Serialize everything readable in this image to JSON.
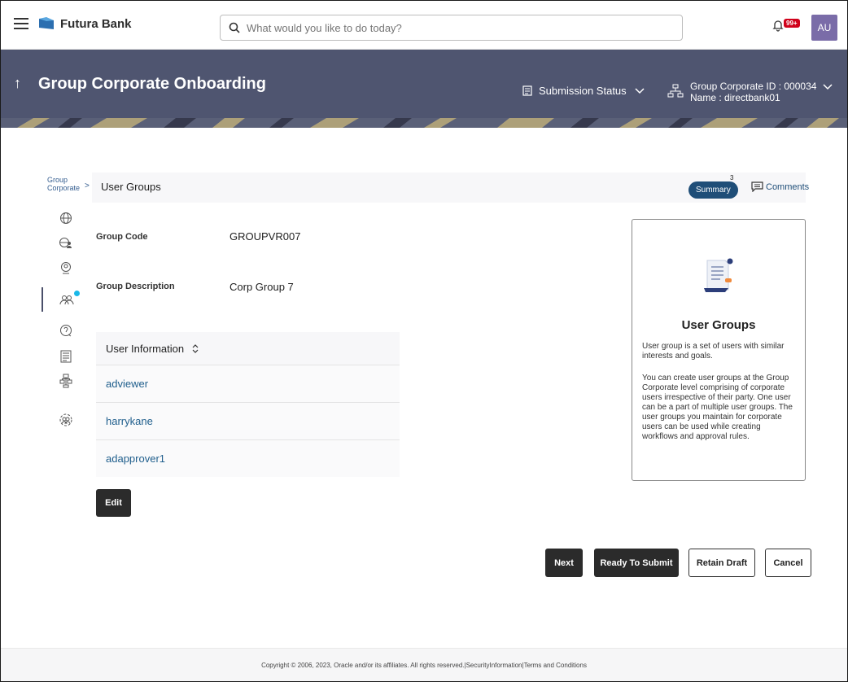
{
  "topbar": {
    "brand": "Futura Bank",
    "search_placeholder": "What would you like to do today?",
    "notification_badge": "99+",
    "avatar_initials": "AU"
  },
  "banner": {
    "title": "Group Corporate Onboarding",
    "submission_status_label": "Submission Status",
    "group_corporate_id": "Group Corporate ID : 000034",
    "group_corporate_name": "Name : directbank01"
  },
  "breadcrumb": {
    "parent_line1": "Group",
    "parent_line2": "Corporate",
    "separator": ">",
    "current": "User Groups"
  },
  "actions": {
    "summary_label": "Summary",
    "summary_count": "3",
    "comments_label": "Comments"
  },
  "form": {
    "group_code_label": "Group Code",
    "group_code_value": "GROUPVR007",
    "group_description_label": "Group Description",
    "group_description_value": "Corp Group 7"
  },
  "user_table": {
    "header": "User Information",
    "rows": [
      "adviewer",
      "harrykane",
      "adapprover1"
    ]
  },
  "edit_label": "Edit",
  "help": {
    "title": "User Groups",
    "p1": "User group is a set of users with similar interests and goals.",
    "p2": "You can create user groups at the Group Corporate level comprising of corporate users irrespective of their party. One user can be a part of multiple user groups. The user groups you maintain for corporate users can be used while creating workflows and approval rules."
  },
  "buttons": {
    "next": "Next",
    "ready_to_submit": "Ready To Submit",
    "retain_draft": "Retain Draft",
    "cancel": "Cancel"
  },
  "footer": "Copyright © 2006, 2023, Oracle and/or its affiliates. All rights reserved.|SecurityInformation|Terms and Conditions",
  "colors": {
    "banner": "#4f5570",
    "primary_dark": "#2b2b2b",
    "accent_blue": "#1f4e78",
    "link": "#1f5e8c",
    "notify_dot": "#19b8e8",
    "avatar": "#7a6ca8"
  },
  "rail_icons": [
    "globe-icon",
    "globe-users-icon",
    "user-circle-icon",
    "user-group-icon",
    "support-icon",
    "document-icon",
    "hierarchy-icon",
    "settings-users-icon"
  ]
}
